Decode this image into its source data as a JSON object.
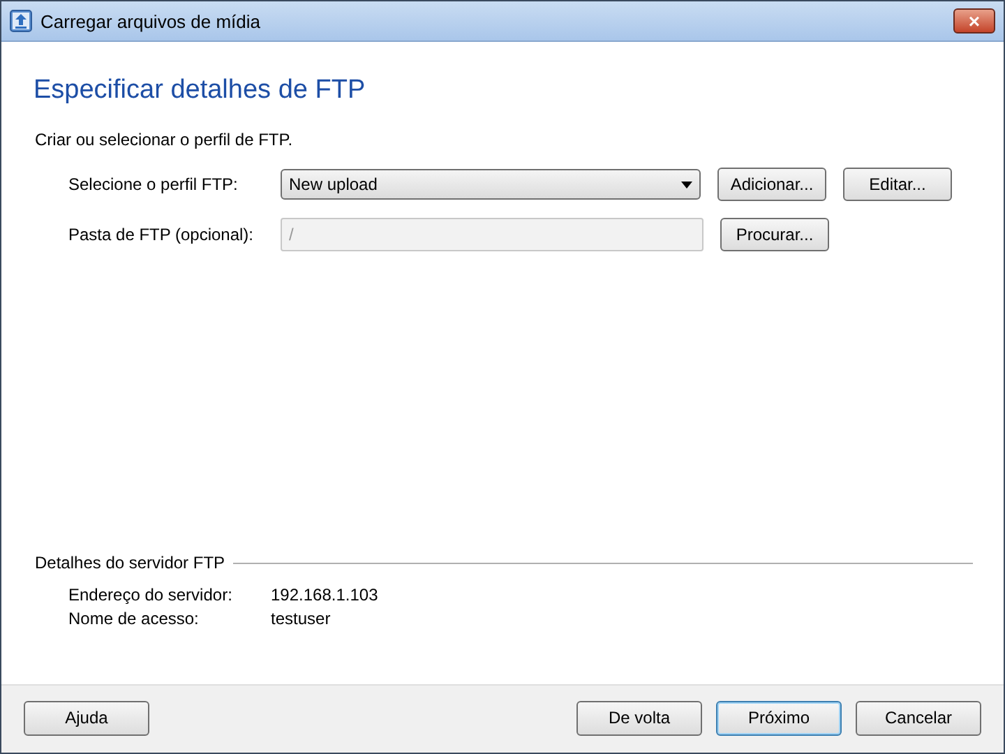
{
  "window": {
    "title": "Carregar arquivos de mídia",
    "close": "×"
  },
  "heading": "Especificar detalhes de FTP",
  "intro": "Criar ou selecionar o perfil de FTP.",
  "profile": {
    "label": "Selecione o perfil FTP:",
    "value": "New upload",
    "buttons": [
      "Adicionar...",
      "Editar..."
    ]
  },
  "folder": {
    "label": "Pasta de FTP (opcional):",
    "value": "/",
    "disabled": true,
    "button": "Procurar..."
  },
  "server_details": {
    "title": "Detalhes do servidor FTP",
    "rows": [
      {
        "label": "Endereço do servidor:",
        "value": "192.168.1.103"
      },
      {
        "label": "Nome de acesso:",
        "value": "testuser"
      }
    ]
  },
  "footer": {
    "help": "Ajuda",
    "buttons": [
      {
        "label": "De volta",
        "default": false
      },
      {
        "label": "Próximo",
        "default": true
      },
      {
        "label": "Cancelar",
        "default": false
      }
    ]
  }
}
